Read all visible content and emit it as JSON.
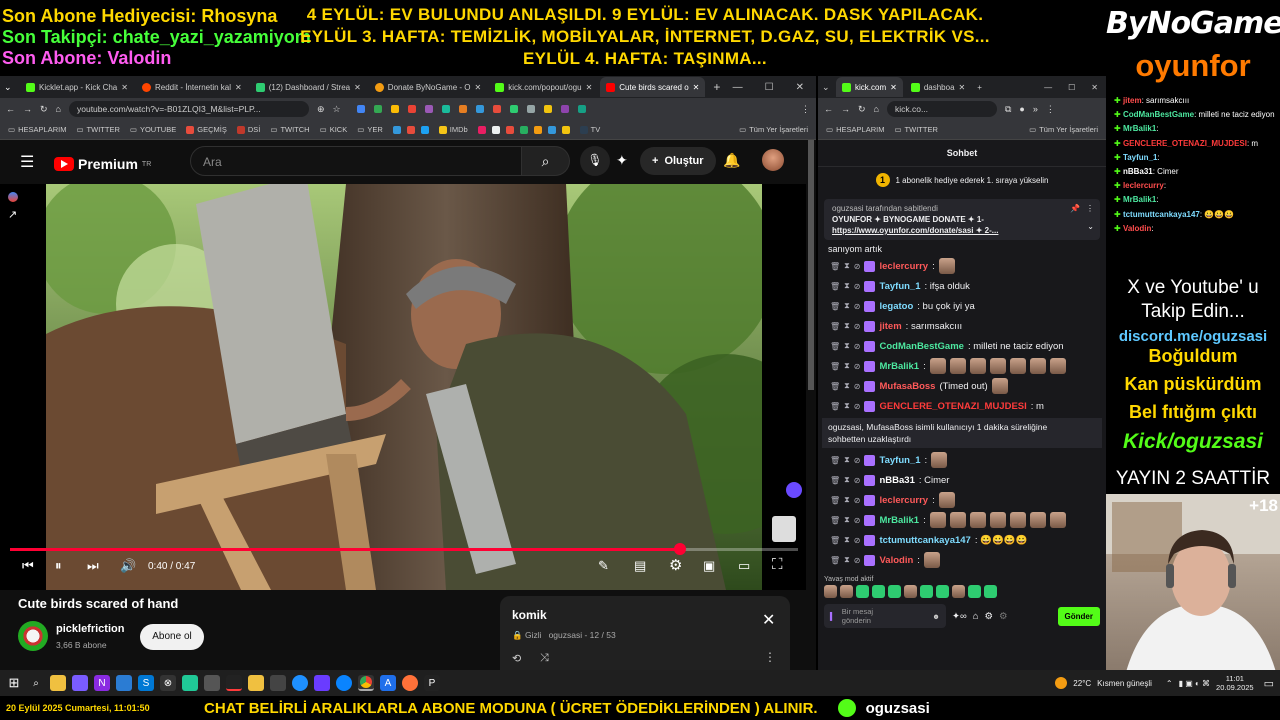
{
  "overlay": {
    "top_left": {
      "line1": "Son Abone Hediyecisi: Rhosyna",
      "line2": "Son Takipçi: chate_yazi_yazamiyom",
      "line3": "Son Abone: Valodin"
    },
    "announcement": {
      "line1": "4 EYLÜL: EV BULUNDU ANLAŞILDI. 9 EYLÜL: EV ALINACAK. DASK YAPILACAK.",
      "line2": "EYLÜL 3. HAFTA: TEMİZLİK, MOBİLYALAR, İNTERNET, D.GAZ, SU, ELEKTRİK VS...",
      "line3": "EYLÜL 4. HAFTA: TAŞINMA..."
    },
    "logo1": "ByNoGame",
    "logo2": "oyunfor",
    "overlay_chat": [
      {
        "user": "jitem",
        "text": ": sarımsakcııı",
        "color": "#ff4d4d"
      },
      {
        "user": "CodManBestGame",
        "text": ": milleti ne taciz ediyon",
        "color": "#4de8a0"
      },
      {
        "user": "MrBalik1",
        "text": ":",
        "color": "#4de8a0"
      },
      {
        "user": "GENCLERE_OTENAZI_MUJDESI",
        "text": ": m",
        "color": "#ff3b3b"
      },
      {
        "user": "Tayfun_1",
        "text": ":",
        "color": "#7fdcff"
      },
      {
        "user": "nBBa31",
        "text": ": Cimer",
        "color": "#ffffff"
      },
      {
        "user": "leclercurry",
        "text": ":",
        "color": "#ff4d4d"
      },
      {
        "user": "MrBalik1",
        "text": ":",
        "color": "#4de8a0"
      },
      {
        "user": "tctumuttcankaya147",
        "text": ": 😀😀😀",
        "color": "#7fdcff"
      },
      {
        "user": "Valodin",
        "text": ":",
        "color": "#ff4d4d"
      }
    ],
    "promo": {
      "line1": "X ve Youtube' u",
      "line2": "Takip Edin...",
      "discord": "discord.me/oguzsasi",
      "s1": "Boğuldum",
      "s2": "Kan püskürdüm",
      "s3": "Bel fıtığım çıktı",
      "kick": "Kick/oguzsasi",
      "uptime": "YAYIN 2 SAATTİR",
      "age": "+18"
    },
    "bottom_date": "20 Eylül 2025 Cumartesi, 11:01:50",
    "bottom_ticker": "CHAT BELİRLİ ARALIKLARLA ABONE MODUNA ( ÜCRET ÖDEDİKLERİNDEN ) ALINIR.",
    "bottom_channel": "oguzsasi"
  },
  "browser_left": {
    "tabs": [
      "Kicklet.app - Kick Cha",
      "Reddit - İnternetin kal",
      "(12) Dashboard / Strea",
      "Donate ByNoGame - O",
      "kick.com/popout/ogu",
      "Cute birds scared o"
    ],
    "url": "youtube.com/watch?v=-B01ZLQI3_M&list=PLP...",
    "bookmarks": [
      "HESAPLARIM",
      "TWITTER",
      "YOUTUBE",
      "GEÇMİŞ",
      "DSİ",
      "TWITCH",
      "KICK",
      "YER",
      "IMDb",
      "TV"
    ],
    "bookmarks_right": "Tüm Yer İşaretleri"
  },
  "youtube": {
    "brand": "Premium",
    "brand_sup": "TR",
    "search_placeholder": "Ara",
    "create_label": "Oluştur",
    "time": "0:40 / 0:47",
    "progress": 0.85,
    "video_title": "Cute birds scared of hand",
    "channel": "picklefriction",
    "subs": "3,66 B abone",
    "subscribe": "Abone ol",
    "playlist_title": "komik",
    "playlist_privacy": "Gizli",
    "playlist_meta": "oguzsasi - 12 / 53"
  },
  "browser_right": {
    "tabs": [
      "kick.com",
      "dashboa"
    ],
    "url": "kick.co...",
    "bookmarks": [
      "HESAPLARIM",
      "TWITTER"
    ],
    "bookmarks_right": "Tüm Yer İşaretleri"
  },
  "chat": {
    "header": "Sohbet",
    "gift_text": "1 abonelik hediye ederek 1. sıraya yükselin",
    "gift_number": "1",
    "pinned_by": "oguzsasi tarafından sabitlendi",
    "pinned_text": "OYUNFOR ✦ BYNOGAME DONATE ✦ 1-",
    "pinned_link": "https://www.oyunfor.com/donate/sasi ✦ 2-...",
    "prev_text": "sanıyom artık",
    "messages": [
      {
        "user": "leclercurry",
        "text": ":",
        "color": "#ff5a5a"
      },
      {
        "user": "Tayfun_1",
        "text": ": ifşa olduk",
        "color": "#7fdcff"
      },
      {
        "user": "legatoo",
        "text": ": bu çok iyi ya",
        "color": "#7fdcff"
      },
      {
        "user": "jitem",
        "text": ": sarımsakcııı",
        "color": "#ff5a5a"
      },
      {
        "user": "CodManBestGame",
        "text": ": milleti ne taciz ediyon",
        "color": "#4de8a0"
      },
      {
        "user": "MrBalik1",
        "text": ":",
        "color": "#4de8a0"
      },
      {
        "user": "MufasaBoss",
        "text": "(Timed out)",
        "color": "#ff5a5a"
      },
      {
        "user": "GENCLERE_OTENAZI_MUJDESI",
        "text": ": m",
        "color": "#ff3b3b"
      }
    ],
    "system_line1": "oguzsasi, MufasaBoss isimli kullanıcıyı 1 dakika süreliğine",
    "system_line2": "sohbetten uzaklaştırdı",
    "messages2": [
      {
        "user": "Tayfun_1",
        "text": ":",
        "color": "#7fdcff"
      },
      {
        "user": "nBBa31",
        "text": ": Cimer",
        "color": "#ffffff"
      },
      {
        "user": "leclercurry",
        "text": ":",
        "color": "#ff5a5a"
      },
      {
        "user": "MrBalik1",
        "text": ":",
        "color": "#4de8a0"
      },
      {
        "user": "tctumuttcankaya147",
        "text": ": 😀😀😀😀",
        "color": "#7fdcff"
      },
      {
        "user": "Valodin",
        "text": ":",
        "color": "#ff5a5a"
      }
    ],
    "slow_mode": "Yavaş mod aktif",
    "input_placeholder": "Bir mesaj gönderin",
    "send": "Gönder"
  },
  "taskbar": {
    "weather_temp": "22°C",
    "weather_text": "Kısmen güneşli",
    "time": "11:01",
    "date": "20.09.2025"
  }
}
